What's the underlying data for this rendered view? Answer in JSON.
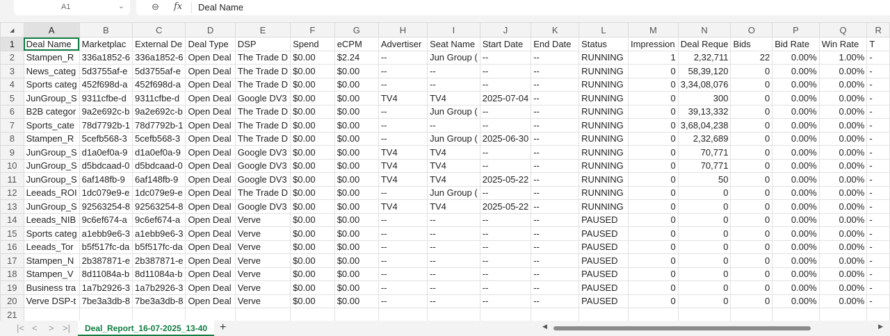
{
  "formula_bar": {
    "cell_ref": "A1",
    "zoom_icon": "magnifier-icon",
    "fx": "fx",
    "value": "Deal Name"
  },
  "columns": [
    "A",
    "B",
    "C",
    "D",
    "E",
    "F",
    "G",
    "H",
    "I",
    "J",
    "K",
    "L",
    "M",
    "N",
    "O",
    "P",
    "Q",
    "R"
  ],
  "numeric_columns": [
    12,
    13,
    14,
    15,
    16
  ],
  "rows": [
    [
      "Deal Name",
      "Marketplac",
      "External De",
      "Deal Type",
      "DSP",
      "Spend",
      "eCPM",
      "Advertiser",
      "Seat Name",
      "Start Date",
      "End Date",
      "Status",
      "Impression",
      "Deal Reque",
      "Bids",
      "Bid Rate",
      "Win Rate",
      "T"
    ],
    [
      "Stampen_R",
      "336a1852-6",
      "336a1852-6",
      "Open Deal",
      "The Trade D",
      "$0.00",
      "$2.24",
      "--",
      "Jun Group (",
      "--",
      "--",
      "RUNNING",
      "1",
      "2,32,711",
      "22",
      "0.00%",
      "1.00%",
      "-"
    ],
    [
      "News_categ",
      "5d3755af-e",
      "5d3755af-e",
      "Open Deal",
      "The Trade D",
      "$0.00",
      "$0.00",
      "--",
      "--",
      "--",
      "--",
      "RUNNING",
      "0",
      "58,39,120",
      "0",
      "0.00%",
      "0.00%",
      "-"
    ],
    [
      "Sports categ",
      "452f698d-a",
      "452f698d-a",
      "Open Deal",
      "The Trade D",
      "$0.00",
      "$0.00",
      "--",
      "--",
      "--",
      "--",
      "RUNNING",
      "0",
      "3,34,08,076",
      "0",
      "0.00%",
      "0.00%",
      "-"
    ],
    [
      "JunGroup_S",
      "9311cfbe-d",
      "9311cfbe-d",
      "Open Deal",
      "Google DV3",
      "$0.00",
      "$0.00",
      "TV4",
      "TV4",
      "2025-07-04",
      "--",
      "RUNNING",
      "0",
      "300",
      "0",
      "0.00%",
      "0.00%",
      "-"
    ],
    [
      "B2B categor",
      "9a2e692c-b",
      "9a2e692c-b",
      "Open Deal",
      "The Trade D",
      "$0.00",
      "$0.00",
      "--",
      "Jun Group (",
      "--",
      "--",
      "RUNNING",
      "0",
      "39,13,332",
      "0",
      "0.00%",
      "0.00%",
      "-"
    ],
    [
      "Sports_cate",
      "78d7792b-1",
      "78d7792b-1",
      "Open Deal",
      "The Trade D",
      "$0.00",
      "$0.00",
      "--",
      "--",
      "--",
      "--",
      "RUNNING",
      "0",
      "3,68,04,238",
      "0",
      "0.00%",
      "0.00%",
      "-"
    ],
    [
      "Stampen_R",
      "5cefb568-3",
      "5cefb568-3",
      "Open Deal",
      "The Trade D",
      "$0.00",
      "$0.00",
      "--",
      "Jun Group (",
      "2025-06-30",
      "--",
      "RUNNING",
      "0",
      "2,32,689",
      "0",
      "0.00%",
      "0.00%",
      "-"
    ],
    [
      "JunGroup_S",
      "d1a0ef0a-9",
      "d1a0ef0a-9",
      "Open Deal",
      "Google DV3",
      "$0.00",
      "$0.00",
      "TV4",
      "TV4",
      "--",
      "--",
      "RUNNING",
      "0",
      "70,771",
      "0",
      "0.00%",
      "0.00%",
      "-"
    ],
    [
      "JunGroup_S",
      "d5bdcaad-0",
      "d5bdcaad-0",
      "Open Deal",
      "Google DV3",
      "$0.00",
      "$0.00",
      "TV4",
      "TV4",
      "--",
      "--",
      "RUNNING",
      "0",
      "70,771",
      "0",
      "0.00%",
      "0.00%",
      "-"
    ],
    [
      "JunGroup_S",
      "6af148fb-9",
      "6af148fb-9",
      "Open Deal",
      "Google DV3",
      "$0.00",
      "$0.00",
      "TV4",
      "TV4",
      "2025-05-22",
      "--",
      "RUNNING",
      "0",
      "50",
      "0",
      "0.00%",
      "0.00%",
      "-"
    ],
    [
      "Leeads_ROI",
      "1dc079e9-e",
      "1dc079e9-e",
      "Open Deal",
      "The Trade D",
      "$0.00",
      "$0.00",
      "--",
      "Jun Group (",
      "--",
      "--",
      "RUNNING",
      "0",
      "0",
      "0",
      "0.00%",
      "0.00%",
      "-"
    ],
    [
      "JunGroup_S",
      "92563254-8",
      "92563254-8",
      "Open Deal",
      "Google DV3",
      "$0.00",
      "$0.00",
      "TV4",
      "TV4",
      "2025-05-22",
      "--",
      "RUNNING",
      "0",
      "0",
      "0",
      "0.00%",
      "0.00%",
      "-"
    ],
    [
      "Leeads_NIB",
      "9c6ef674-a",
      "9c6ef674-a",
      "Open Deal",
      "Verve",
      "$0.00",
      "$0.00",
      "--",
      "--",
      "--",
      "--",
      "PAUSED",
      "0",
      "0",
      "0",
      "0.00%",
      "0.00%",
      "-"
    ],
    [
      "Sports categ",
      "a1ebb9e6-3",
      "a1ebb9e6-3",
      "Open Deal",
      "Verve",
      "$0.00",
      "$0.00",
      "--",
      "--",
      "--",
      "--",
      "PAUSED",
      "0",
      "0",
      "0",
      "0.00%",
      "0.00%",
      "-"
    ],
    [
      "Leeads_Tor",
      "b5f517fc-da",
      "b5f517fc-da",
      "Open Deal",
      "Verve",
      "$0.00",
      "$0.00",
      "--",
      "--",
      "--",
      "--",
      "PAUSED",
      "0",
      "0",
      "0",
      "0.00%",
      "0.00%",
      "-"
    ],
    [
      "Stampen_N",
      "2b387871-e",
      "2b387871-e",
      "Open Deal",
      "Verve",
      "$0.00",
      "$0.00",
      "--",
      "--",
      "--",
      "--",
      "PAUSED",
      "0",
      "0",
      "0",
      "0.00%",
      "0.00%",
      "-"
    ],
    [
      "Stampen_V",
      "8d11084a-b",
      "8d11084a-b",
      "Open Deal",
      "Verve",
      "$0.00",
      "$0.00",
      "--",
      "--",
      "--",
      "--",
      "PAUSED",
      "0",
      "0",
      "0",
      "0.00%",
      "0.00%",
      "-"
    ],
    [
      "Business tra",
      "1a7b2926-3",
      "1a7b2926-3",
      "Open Deal",
      "Verve",
      "$0.00",
      "$0.00",
      "--",
      "--",
      "--",
      "--",
      "PAUSED",
      "0",
      "0",
      "0",
      "0.00%",
      "0.00%",
      "-"
    ],
    [
      "Verve DSP-t",
      "7be3a3db-8",
      "7be3a3db-8",
      "Open Deal",
      "Verve",
      "$0.00",
      "$0.00",
      "--",
      "--",
      "--",
      "--",
      "PAUSED",
      "0",
      "0",
      "0",
      "0.00%",
      "0.00%",
      "-"
    ],
    [
      "",
      "",
      "",
      "",
      "",
      "",
      "",
      "",
      "",
      "",
      "",
      "",
      "",
      "",
      "",
      "",
      "",
      ""
    ]
  ],
  "sheet_tabs": {
    "active": "Deal_Report_16-07-2025_13-40",
    "add": "+",
    "nav": [
      "|<",
      "<",
      ">",
      ">|"
    ]
  },
  "colors": {
    "accent": "#107c41"
  }
}
